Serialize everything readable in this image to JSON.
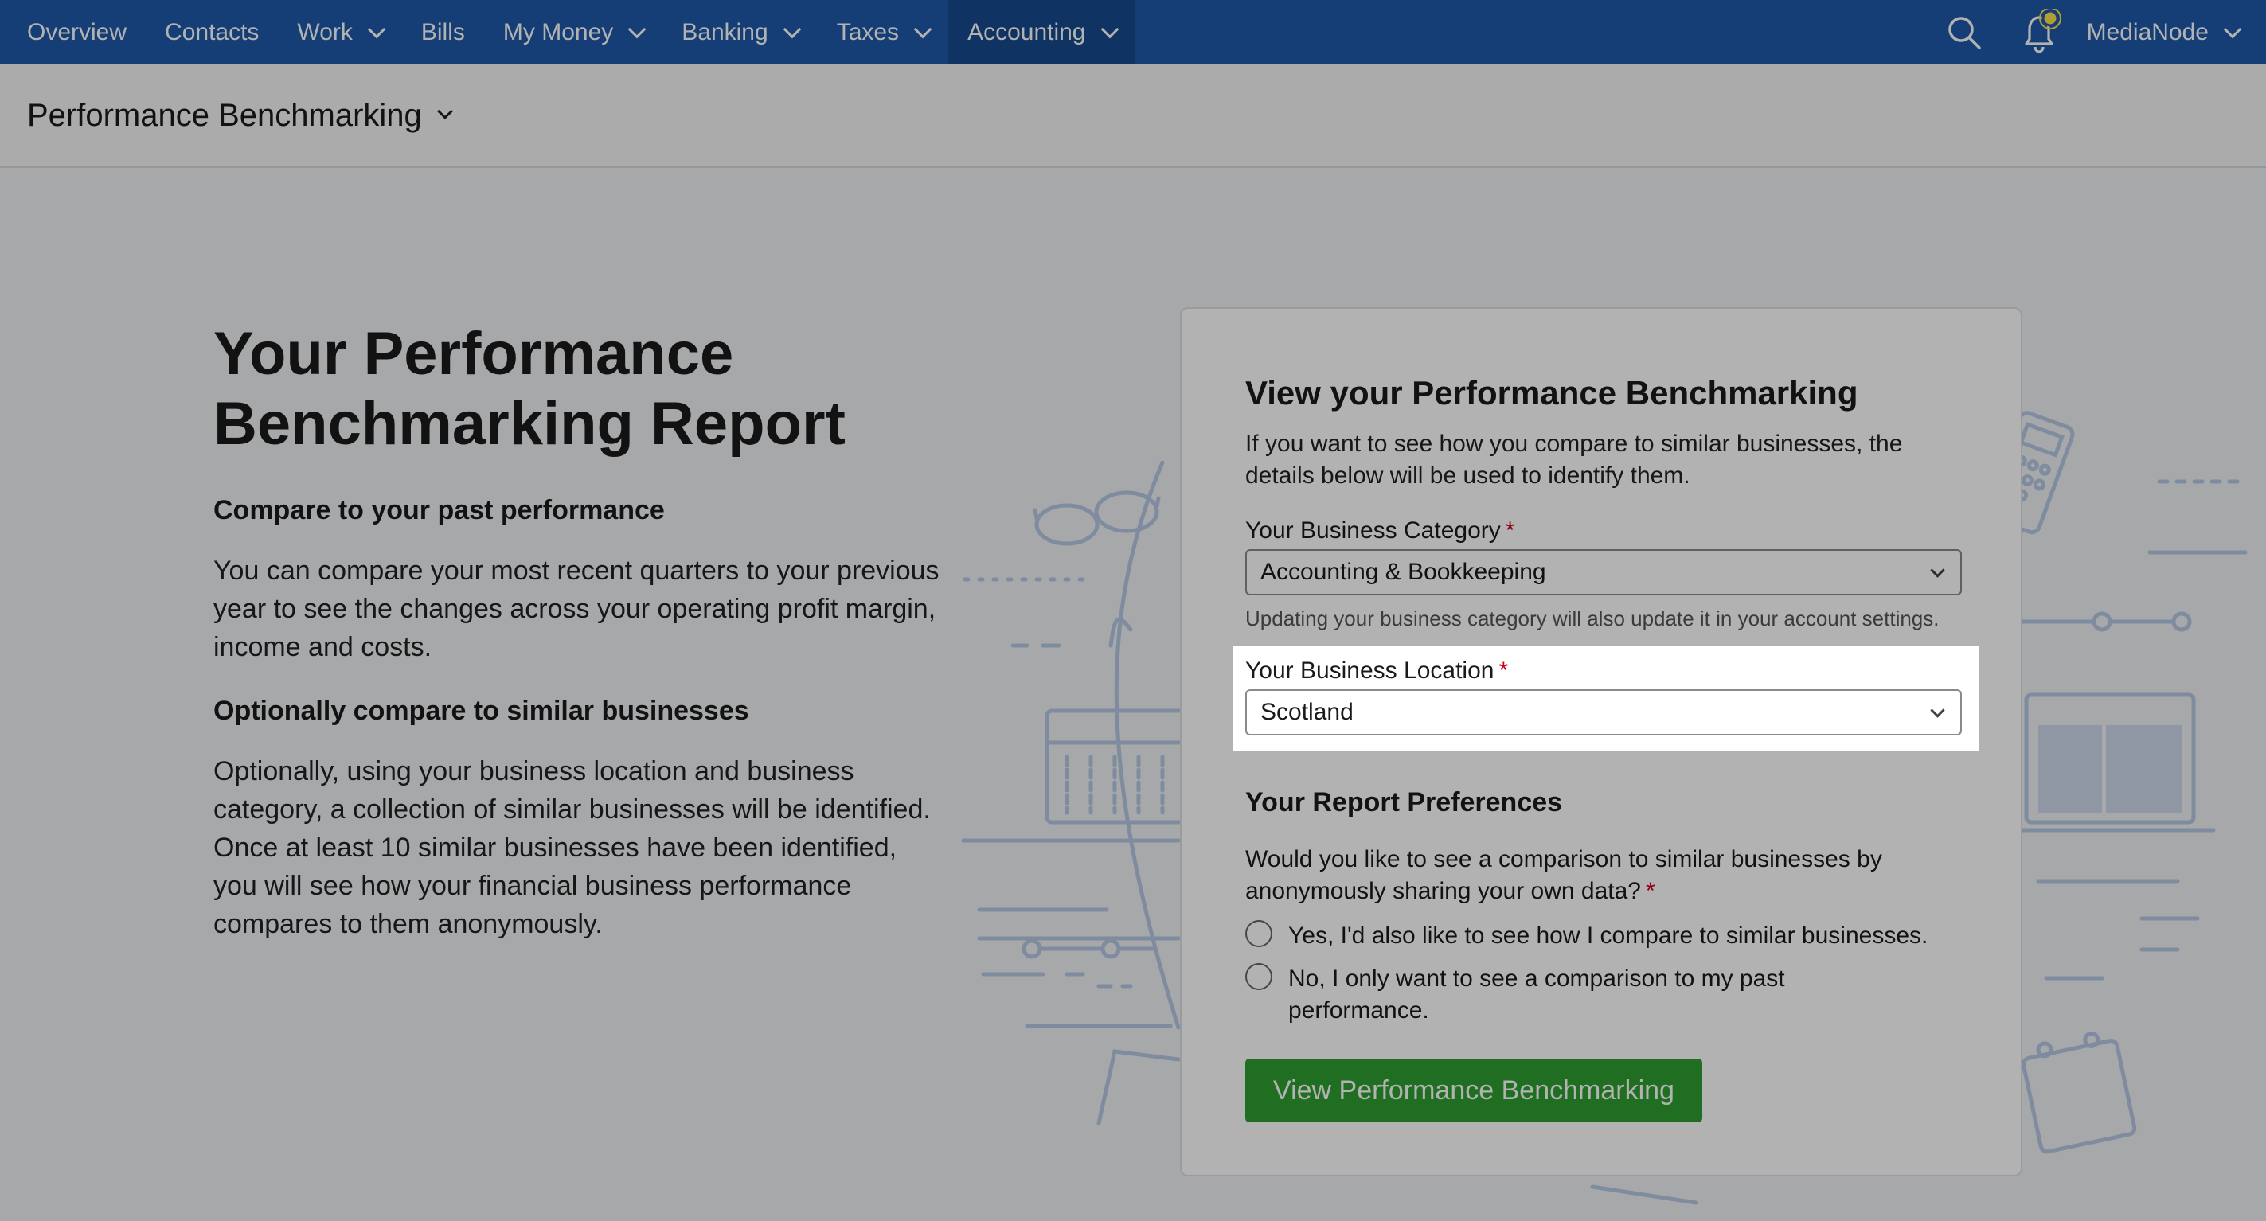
{
  "nav": {
    "items": [
      {
        "label": "Overview",
        "has_dropdown": false,
        "active": false
      },
      {
        "label": "Contacts",
        "has_dropdown": false,
        "active": false
      },
      {
        "label": "Work",
        "has_dropdown": true,
        "active": false
      },
      {
        "label": "Bills",
        "has_dropdown": false,
        "active": false
      },
      {
        "label": "My Money",
        "has_dropdown": true,
        "active": false
      },
      {
        "label": "Banking",
        "has_dropdown": true,
        "active": false
      },
      {
        "label": "Taxes",
        "has_dropdown": true,
        "active": false
      },
      {
        "label": "Accounting",
        "has_dropdown": true,
        "active": true
      }
    ],
    "account_name": "MediaNode",
    "icons": [
      "search-icon",
      "bell-icon"
    ]
  },
  "subheader": {
    "title": "Performance Benchmarking"
  },
  "intro": {
    "title": "Your Performance Benchmarking Report",
    "section1_heading": "Compare to your past performance",
    "section1_text": "You can compare your most recent quarters to your previous year to see the changes across your operating profit margin, income and costs.",
    "section2_heading": "Optionally compare to similar businesses",
    "section2_text": "Optionally, using your business location and business category, a collection of similar businesses will be identified. Once at least 10 similar businesses have been identified, you will see how your financial business performance compares to them anonymously."
  },
  "card": {
    "title": "View your Performance Benchmarking",
    "lead": "If you want to see how you compare to similar businesses, the details below will be used to identify them.",
    "category_label": "Your Business Category",
    "category_value": "Accounting & Bookkeeping",
    "category_help": "Updating your business category will also update it in your account settings.",
    "location_label": "Your Business Location",
    "location_value": "Scotland",
    "required_mark": "*",
    "prefs_heading": "Your Report Preferences",
    "prefs_question": "Would you like to see a comparison to similar businesses by anonymously sharing your own data?",
    "option_yes": "Yes, I'd also like to see how I compare to similar businesses.",
    "option_no": "No, I only want to see a comparison to my past performance.",
    "submit_label": "View Performance Benchmarking"
  },
  "colors": {
    "nav_bg": "#1e5aa8",
    "nav_active_bg": "#164a8d",
    "primary_button": "#2f9e31",
    "required": "#d0021b",
    "notification_dot": "#ffe14d"
  }
}
